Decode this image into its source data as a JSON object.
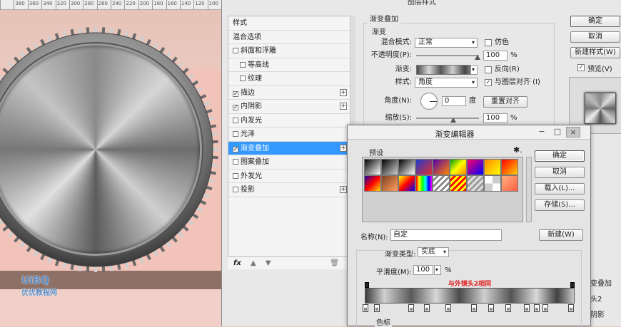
{
  "ruler": {
    "ticks": [
      "",
      "380",
      "360",
      "340",
      "320",
      "300",
      "280",
      "260",
      "240",
      "220",
      "200",
      "180",
      "160",
      "140",
      "120",
      "100"
    ]
  },
  "watermark": {
    "line1": "UiBQ",
    "line2": "优优教程网"
  },
  "layer_style": {
    "title": "图层样式",
    "list": [
      {
        "label": "样式",
        "checkbox": false,
        "indent": false,
        "plus": false,
        "selected": false,
        "checked": false
      },
      {
        "label": "混合选项",
        "checkbox": false,
        "indent": false,
        "plus": false,
        "selected": false,
        "checked": false
      },
      {
        "label": "斜面和浮雕",
        "checkbox": true,
        "indent": false,
        "plus": false,
        "selected": false,
        "checked": false
      },
      {
        "label": "等高线",
        "checkbox": true,
        "indent": true,
        "plus": false,
        "selected": false,
        "checked": false
      },
      {
        "label": "纹理",
        "checkbox": true,
        "indent": true,
        "plus": false,
        "selected": false,
        "checked": false
      },
      {
        "label": "描边",
        "checkbox": true,
        "indent": false,
        "plus": true,
        "selected": false,
        "checked": true
      },
      {
        "label": "内阴影",
        "checkbox": true,
        "indent": false,
        "plus": true,
        "selected": false,
        "checked": true
      },
      {
        "label": "内发光",
        "checkbox": true,
        "indent": false,
        "plus": false,
        "selected": false,
        "checked": false
      },
      {
        "label": "光泽",
        "checkbox": true,
        "indent": false,
        "plus": false,
        "selected": false,
        "checked": false
      },
      {
        "label": "渐变叠加",
        "checkbox": true,
        "indent": false,
        "plus": true,
        "selected": true,
        "checked": true
      },
      {
        "label": "图案叠加",
        "checkbox": true,
        "indent": false,
        "plus": false,
        "selected": false,
        "checked": false
      },
      {
        "label": "外发光",
        "checkbox": true,
        "indent": false,
        "plus": false,
        "selected": false,
        "checked": false
      },
      {
        "label": "投影",
        "checkbox": true,
        "indent": false,
        "plus": true,
        "selected": false,
        "checked": false
      }
    ],
    "fx_label": "fx",
    "group_title": "渐变叠加",
    "sub_title": "渐变",
    "blend_mode_label": "混合模式:",
    "blend_mode_value": "正常",
    "dither_label": "仿色",
    "opacity_label": "不透明度(P):",
    "opacity_value": "100",
    "percent": "%",
    "gradient_label": "渐变:",
    "reverse_label": "反向(R)",
    "style_label": "样式:",
    "style_value": "角度",
    "align_label": "与图层对齐 (I)",
    "angle_label": "角度(N):",
    "angle_value": "0",
    "degree": "度",
    "reset_align": "重置对齐",
    "scale_label": "缩放(S):",
    "scale_value": "100",
    "ok": "确定",
    "cancel": "取消",
    "new_style": "新建样式(W)",
    "preview": "预览(V)",
    "under_right": [
      "变叠加",
      "头2",
      "阴影"
    ]
  },
  "gradient_editor": {
    "title": "渐变编辑器",
    "minimize": "−",
    "maximize": "□",
    "close": "×",
    "presets_label": "预设",
    "gear": "✱.",
    "ok": "确定",
    "cancel": "取消",
    "load": "载入(L)...",
    "save": "存储(S)...",
    "name_label": "名称(N):",
    "name_value": "自定",
    "new_button": "新建(W)",
    "type_label": "渐变类型:",
    "type_value": "实底",
    "smooth_label": "平滑度(M):",
    "smooth_value": "100",
    "percent": "%",
    "note": "与外镜头2相同",
    "colorstop_label": "色标",
    "preset_swatches": [
      "linear-gradient(135deg,#000,#fff)",
      "linear-gradient(135deg,#000,#fff0)",
      "linear-gradient(135deg,#000,#fff)",
      "linear-gradient(135deg,#1f3ccc,#e03030)",
      "linear-gradient(135deg,#5500aa,#ff8800)",
      "linear-gradient(135deg,#00a000,#ffff00,#ff8000)",
      "linear-gradient(135deg,#ff0066,#0000ff)",
      "linear-gradient(135deg,#ff8800,#ffff00)",
      "linear-gradient(135deg,#ff0000,#ffd000)",
      "linear-gradient(135deg,#2000a0,#ff0000,#ffe000)",
      "linear-gradient(135deg,#804020,#ffa060)",
      "linear-gradient(135deg,#ffff00,#ff0000,#0000ff)",
      "linear-gradient(90deg,#f00,#ff0,#0f0,#0ff,#00f,#f0f)",
      "repeating-linear-gradient(135deg,#fff 0 3px,#888 3px 6px)",
      "repeating-linear-gradient(135deg,#ff0 0 3px,#f00 3px 6px)",
      "repeating-linear-gradient(135deg,#ddd 0 3px,#999 3px 6px)",
      "repeating-conic-gradient(#ccc 0 25%,#fff 0 50%)",
      "linear-gradient(135deg,#ffb080,#ff6040)"
    ]
  }
}
